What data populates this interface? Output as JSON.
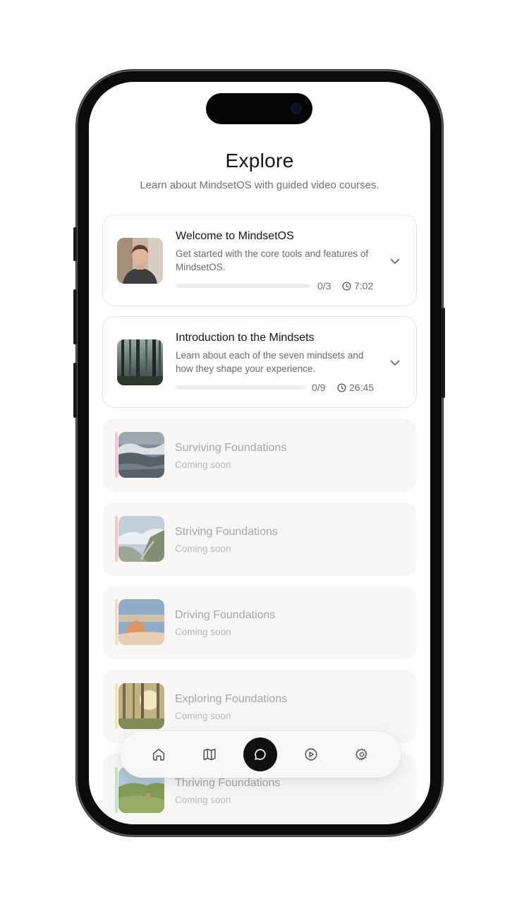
{
  "header": {
    "title": "Explore",
    "subtitle": "Learn about MindsetOS with guided video courses."
  },
  "courses": [
    {
      "title": "Welcome to MindsetOS",
      "description": "Get started with the core tools and features of MindsetOS.",
      "progress_label": "0/3",
      "progress": 0,
      "duration": "7:02",
      "thumbnail": "presenter-photo"
    },
    {
      "title": "Introduction to the Mindsets",
      "description": "Learn about each of the seven mindsets and how they shape your experience.",
      "progress_label": "0/9",
      "progress": 0,
      "duration": "26:45",
      "thumbnail": "forest-photo"
    }
  ],
  "upcoming": [
    {
      "title": "Surviving Foundations",
      "status": "Coming soon",
      "accent": "#f5c6d6",
      "thumbnail": "ocean-wave-photo"
    },
    {
      "title": "Striving Foundations",
      "status": "Coming soon",
      "accent": "#f8c9c3",
      "thumbnail": "mountain-ridge-photo"
    },
    {
      "title": "Driving Foundations",
      "status": "Coming soon",
      "accent": "#f8dcc2",
      "thumbnail": "desert-rock-photo"
    },
    {
      "title": "Exploring Foundations",
      "status": "Coming soon",
      "accent": "#f7e6a6",
      "thumbnail": "sunlit-forest-photo"
    },
    {
      "title": "Thriving Foundations",
      "status": "Coming soon",
      "accent": "#bfe8c8",
      "thumbnail": "green-hills-photo"
    }
  ],
  "nav": {
    "items": [
      "home-icon",
      "map-icon",
      "chat-icon",
      "play-icon",
      "gear-icon"
    ],
    "active": "chat-icon"
  }
}
